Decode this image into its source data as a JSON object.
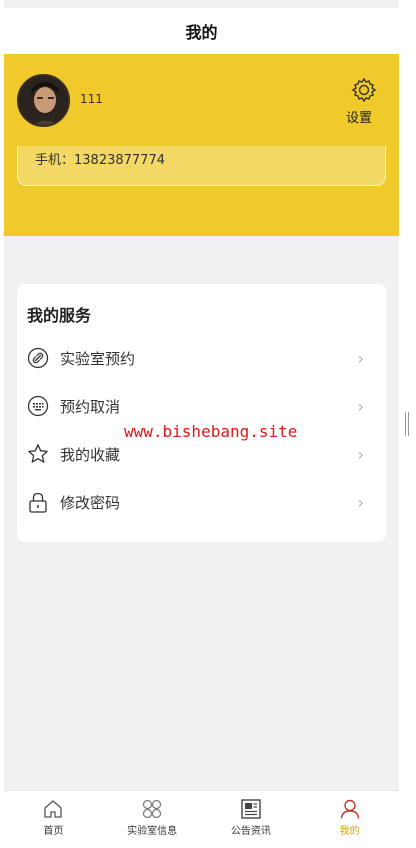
{
  "page_title": "我的",
  "profile": {
    "username": "111",
    "settings_label": "设置",
    "phone_text": "手机：13823877774"
  },
  "services": {
    "title": "我的服务",
    "items": [
      {
        "label": "实验室预约",
        "icon": "link-icon"
      },
      {
        "label": "预约取消",
        "icon": "keyboard-icon"
      },
      {
        "label": "我的收藏",
        "icon": "star-icon"
      },
      {
        "label": "修改密码",
        "icon": "lock-icon"
      }
    ]
  },
  "watermark": "www.bishebang.site",
  "tabbar": {
    "items": [
      {
        "label": "首页",
        "icon": "home-icon",
        "active": false
      },
      {
        "label": "实验室信息",
        "icon": "grid-icon",
        "active": false
      },
      {
        "label": "公告资讯",
        "icon": "news-icon",
        "active": false
      },
      {
        "label": "我的",
        "icon": "user-icon",
        "active": true
      }
    ]
  },
  "colors": {
    "header_bg": "#f0c92a",
    "active_tab": "#d4a017",
    "watermark": "#e01818"
  }
}
